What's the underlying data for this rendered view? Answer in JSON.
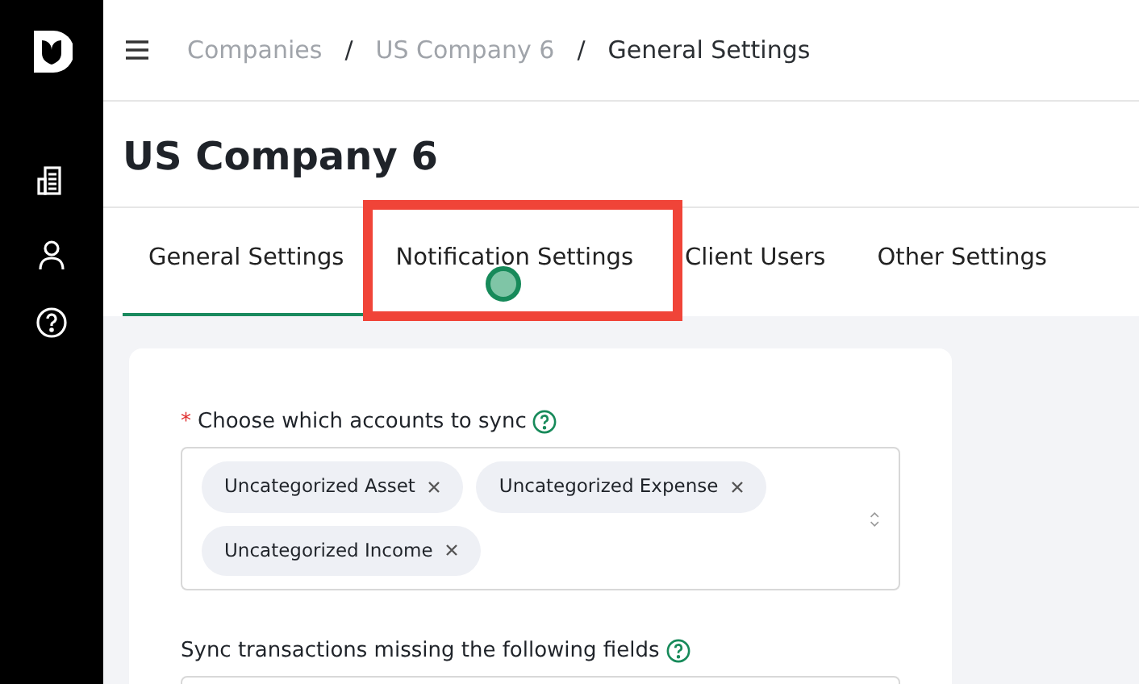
{
  "breadcrumb": [
    {
      "label": "Companies",
      "current": false
    },
    {
      "label": "US Company 6",
      "current": false
    },
    {
      "label": "General Settings",
      "current": true
    }
  ],
  "breadcrumb_separator": "/",
  "page_title": "US Company 6",
  "tabs": [
    {
      "label": "General Settings",
      "selected": true,
      "highlighted": false
    },
    {
      "label": "Notification Settings",
      "selected": false,
      "highlighted": true
    },
    {
      "label": "Client Users",
      "selected": false,
      "highlighted": false
    },
    {
      "label": "Other Settings",
      "selected": false,
      "highlighted": false
    }
  ],
  "form": {
    "required_mark": "*",
    "fields": [
      {
        "label": "Choose which accounts to sync",
        "required": true,
        "tags": [
          "Uncategorized Asset",
          "Uncategorized Expense",
          "Uncategorized Income"
        ]
      },
      {
        "label": "Sync transactions missing the following fields",
        "required": false
      }
    ]
  }
}
